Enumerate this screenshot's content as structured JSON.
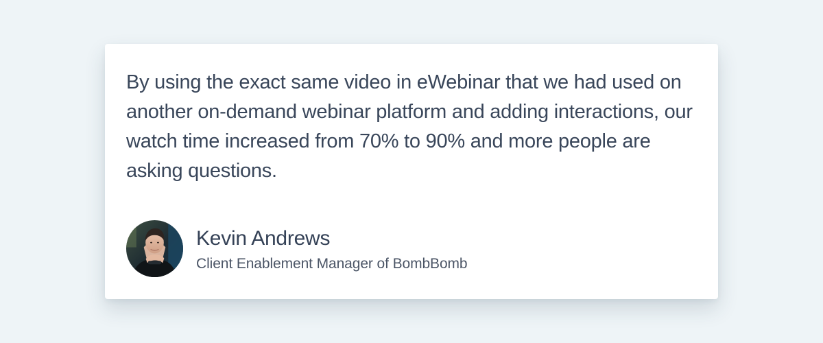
{
  "testimonial": {
    "quote": "By using the exact same video in eWebinar that we had used on another on-demand webinar platform and adding interactions, our watch time increased from 70% to 90% and more people are asking questions.",
    "author_name": "Kevin Andrews",
    "author_role": "Client Enablement Manager of BombBomb",
    "avatar_icon": "person-photo"
  },
  "colors": {
    "page_background": "#eef4f7",
    "card_background": "#ffffff",
    "quote_text": "#39465a",
    "name_text": "#354257",
    "role_text": "#4b5566"
  }
}
